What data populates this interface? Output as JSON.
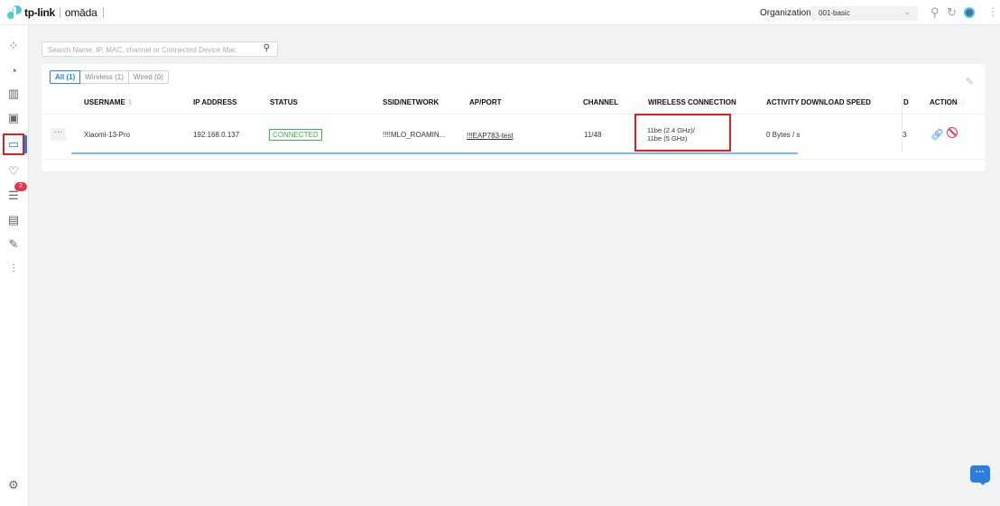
{
  "header": {
    "brand": "tp-link",
    "product": "omāda",
    "org_label": "Organization:",
    "org_value": "001-basic",
    "icons": [
      "search-icon",
      "refresh-icon",
      "user-avatar",
      "more-icon"
    ]
  },
  "sidebar": {
    "items": [
      {
        "icon": "dashboard-icon",
        "glyph": "⁘"
      },
      {
        "icon": "statistics-icon",
        "glyph": "◔"
      },
      {
        "icon": "map-icon",
        "glyph": "▥"
      },
      {
        "icon": "devices-icon",
        "glyph": "▣"
      },
      {
        "icon": "clients-icon",
        "glyph": "▭",
        "active": true
      },
      {
        "icon": "insights-icon",
        "glyph": "♡"
      },
      {
        "icon": "alerts-icon",
        "glyph": "☰",
        "badge": "2"
      },
      {
        "icon": "logs-icon",
        "glyph": "▤"
      },
      {
        "icon": "tools-icon",
        "glyph": "✎"
      },
      {
        "icon": "reports-icon",
        "glyph": "⫶"
      }
    ],
    "settings_icon": "⚙"
  },
  "search": {
    "placeholder": "Search Name, IP, MAC, channel or Connected Device Mac",
    "value": ""
  },
  "tabs": [
    {
      "label": "All (1)",
      "active": true
    },
    {
      "label": "Wireless (1)",
      "active": false
    },
    {
      "label": "Wired (0)",
      "active": false
    }
  ],
  "table": {
    "columns": {
      "username": "USERNAME",
      "ip": "IP ADDRESS",
      "status": "STATUS",
      "ssid": "SSID/NETWORK",
      "ap_port": "AP/PORT",
      "channel": "CHANNEL",
      "wireless": "WIRELESS CONNECTION",
      "download": "ACTIVITY DOWNLOAD SPEED",
      "d_col": "D",
      "action": "ACTION"
    },
    "rows": [
      {
        "more": "···",
        "username": "Xiaomi-13-Pro",
        "ip": "192.168.0.137",
        "status": "CONNECTED",
        "ssid": "!!!!MLO_ROAMIN...",
        "ap_port": "!!!EAP783-test",
        "channel": "11/48",
        "wireless_1": "11be (2.4 GHz)/",
        "wireless_2": "11be (5 GHz)",
        "download": "0 Bytes / s",
        "d_col": "3"
      }
    ]
  },
  "chat": {
    "label": "···"
  }
}
